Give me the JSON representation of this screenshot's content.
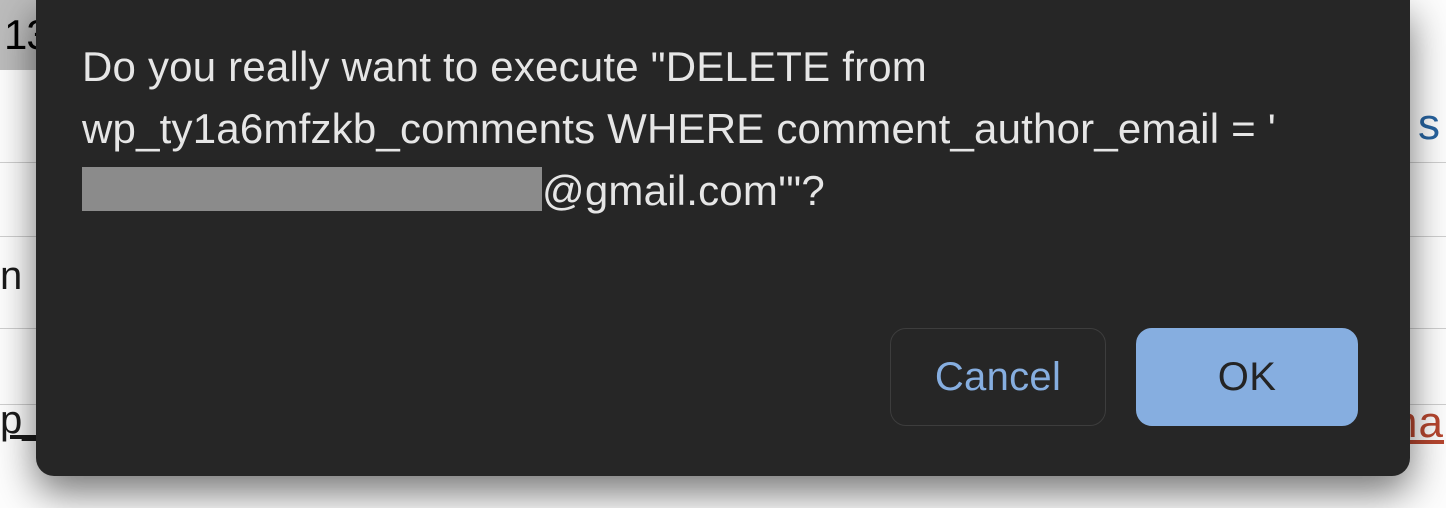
{
  "background": {
    "corner_number": "13",
    "right_char_top": "s",
    "right_char_bottom": "na",
    "left_char_mid": "n",
    "left_char_bottom": "p_"
  },
  "dialog": {
    "message_pre": "Do you really want to execute \"DELETE from wp_ty1a6mfzkb_comments WHERE comment_author_email = '",
    "message_post": "@gmail.com'\"?",
    "buttons": {
      "cancel": "Cancel",
      "ok": "OK"
    }
  }
}
